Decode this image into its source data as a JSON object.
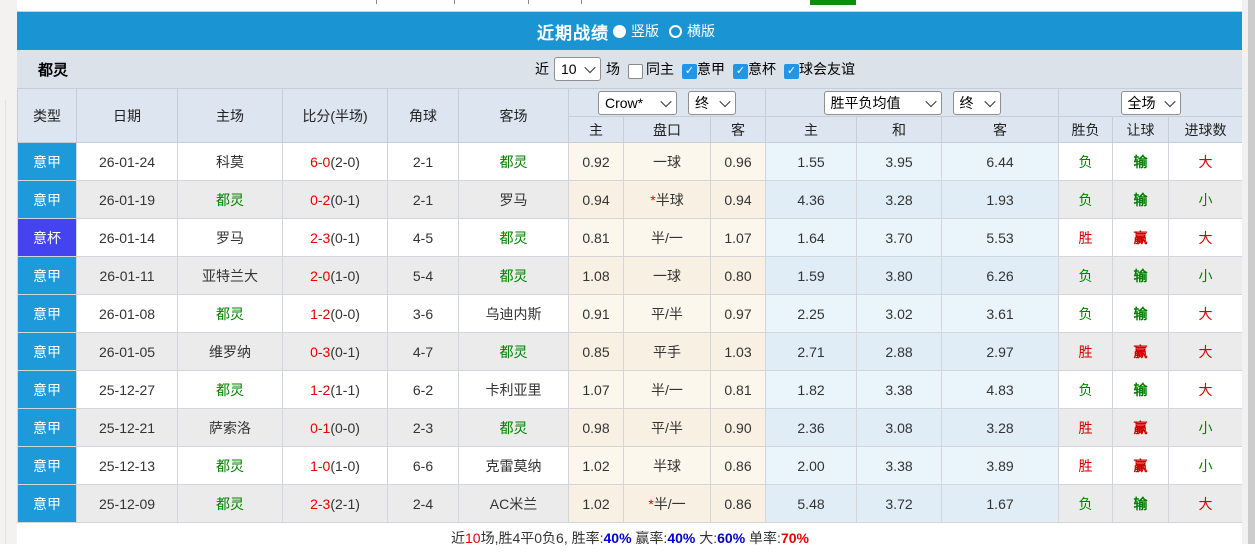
{
  "top_strip": {
    "partial_button_color": "#0b8f0b"
  },
  "title_bar": {
    "title": "近期战绩",
    "options": [
      {
        "label": "竖版",
        "selected": true
      },
      {
        "label": "横版",
        "selected": false
      }
    ]
  },
  "filter_bar": {
    "team": "都灵",
    "near_label": "近",
    "games_value": "10",
    "games_label": "场",
    "checkboxes": [
      {
        "label": "同主",
        "checked": false
      },
      {
        "label": "意甲",
        "checked": true
      },
      {
        "label": "意杯",
        "checked": true
      },
      {
        "label": "球会友谊",
        "checked": true
      }
    ]
  },
  "table": {
    "columns": [
      "类型",
      "日期",
      "主场",
      "比分(半场)",
      "角球",
      "客场"
    ],
    "selects": {
      "odds_source": "Crow*",
      "odds_state": "终",
      "avg_type": "胜平负均值",
      "avg_state": "终",
      "scope": "全场"
    },
    "sub_columns": [
      "主",
      "盘口",
      "客",
      "主",
      "和",
      "客",
      "胜负",
      "让球",
      "进球数"
    ],
    "league_colors": {
      "意甲": "#1e9ada",
      "意杯": "#4343ef"
    },
    "outcome_colors": {
      "胜": "#d10000",
      "负": "#008000",
      "赢": "#d10000",
      "输": "#008000",
      "大": "#d10000",
      "小": "#008000"
    },
    "rows": [
      {
        "type": "意甲",
        "date": "26-01-24",
        "home": "科莫",
        "score_ft": "6-0",
        "score_ht": "2-0",
        "corners": "2-1",
        "away": "都灵",
        "crow_home": "0.92",
        "handicap": "一球",
        "crow_away": "0.96",
        "avg_home": "1.55",
        "avg_draw": "3.95",
        "avg_away": "6.44",
        "wdl": "负",
        "let_result": "输",
        "goals": "大"
      },
      {
        "type": "意甲",
        "date": "26-01-19",
        "home": "都灵",
        "score_ft": "0-2",
        "score_ht": "0-1",
        "corners": "2-1",
        "away": "罗马",
        "crow_home": "0.94",
        "handicap": "*半球",
        "crow_away": "0.94",
        "avg_home": "4.36",
        "avg_draw": "3.28",
        "avg_away": "1.93",
        "wdl": "负",
        "let_result": "输",
        "goals": "小"
      },
      {
        "type": "意杯",
        "date": "26-01-14",
        "home": "罗马",
        "score_ft": "2-3",
        "score_ht": "0-1",
        "corners": "4-5",
        "away": "都灵",
        "crow_home": "0.81",
        "handicap": "半/一",
        "crow_away": "1.07",
        "avg_home": "1.64",
        "avg_draw": "3.70",
        "avg_away": "5.53",
        "wdl": "胜",
        "let_result": "赢",
        "goals": "大"
      },
      {
        "type": "意甲",
        "date": "26-01-11",
        "home": "亚特兰大",
        "score_ft": "2-0",
        "score_ht": "1-0",
        "corners": "5-4",
        "away": "都灵",
        "crow_home": "1.08",
        "handicap": "一球",
        "crow_away": "0.80",
        "avg_home": "1.59",
        "avg_draw": "3.80",
        "avg_away": "6.26",
        "wdl": "负",
        "let_result": "输",
        "goals": "小"
      },
      {
        "type": "意甲",
        "date": "26-01-08",
        "home": "都灵",
        "score_ft": "1-2",
        "score_ht": "0-0",
        "corners": "3-6",
        "away": "乌迪内斯",
        "crow_home": "0.91",
        "handicap": "平/半",
        "crow_away": "0.97",
        "avg_home": "2.25",
        "avg_draw": "3.02",
        "avg_away": "3.61",
        "wdl": "负",
        "let_result": "输",
        "goals": "大"
      },
      {
        "type": "意甲",
        "date": "26-01-05",
        "home": "维罗纳",
        "score_ft": "0-3",
        "score_ht": "0-1",
        "corners": "4-7",
        "away": "都灵",
        "crow_home": "0.85",
        "handicap": "平手",
        "crow_away": "1.03",
        "avg_home": "2.71",
        "avg_draw": "2.88",
        "avg_away": "2.97",
        "wdl": "胜",
        "let_result": "赢",
        "goals": "大"
      },
      {
        "type": "意甲",
        "date": "25-12-27",
        "home": "都灵",
        "score_ft": "1-2",
        "score_ht": "1-1",
        "corners": "6-2",
        "away": "卡利亚里",
        "crow_home": "1.07",
        "handicap": "半/一",
        "crow_away": "0.81",
        "avg_home": "1.82",
        "avg_draw": "3.38",
        "avg_away": "4.83",
        "wdl": "负",
        "let_result": "输",
        "goals": "大"
      },
      {
        "type": "意甲",
        "date": "25-12-21",
        "home": "萨索洛",
        "score_ft": "0-1",
        "score_ht": "0-0",
        "corners": "2-3",
        "away": "都灵",
        "crow_home": "0.98",
        "handicap": "平/半",
        "crow_away": "0.90",
        "avg_home": "2.36",
        "avg_draw": "3.08",
        "avg_away": "3.28",
        "wdl": "胜",
        "let_result": "赢",
        "goals": "小"
      },
      {
        "type": "意甲",
        "date": "25-12-13",
        "home": "都灵",
        "score_ft": "1-0",
        "score_ht": "1-0",
        "corners": "6-6",
        "away": "克雷莫纳",
        "crow_home": "1.02",
        "handicap": "半球",
        "crow_away": "0.86",
        "avg_home": "2.00",
        "avg_draw": "3.38",
        "avg_away": "3.89",
        "wdl": "胜",
        "let_result": "赢",
        "goals": "小"
      },
      {
        "type": "意甲",
        "date": "25-12-09",
        "home": "都灵",
        "score_ft": "2-3",
        "score_ht": "2-1",
        "corners": "2-4",
        "away": "AC米兰",
        "crow_home": "1.02",
        "handicap": "*半/一",
        "crow_away": "0.86",
        "avg_home": "5.48",
        "avg_draw": "3.72",
        "avg_away": "1.67",
        "wdl": "负",
        "let_result": "输",
        "goals": "大"
      }
    ]
  },
  "footer": {
    "segments": [
      {
        "text": "近",
        "color": "#333333"
      },
      {
        "text": "10",
        "color": "#e60000"
      },
      {
        "text": "场,胜4平0负6, ",
        "color": "#333333"
      },
      {
        "text": "胜率:",
        "color": "#333333"
      },
      {
        "text": "40%",
        "color": "#0000cc",
        "bold": true
      },
      {
        "text": " 赢率:",
        "color": "#333333"
      },
      {
        "text": "40%",
        "color": "#0000cc",
        "bold": true
      },
      {
        "text": " 大:",
        "color": "#333333"
      },
      {
        "text": "60%",
        "color": "#0000cc",
        "bold": true
      },
      {
        "text": " 单率:",
        "color": "#333333"
      },
      {
        "text": "70%",
        "color": "#e60000",
        "bold": true
      }
    ]
  }
}
